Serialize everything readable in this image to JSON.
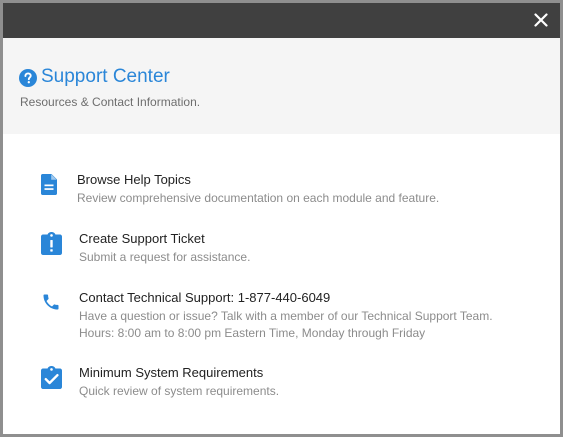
{
  "dialog": {
    "close_icon": "close-icon"
  },
  "header": {
    "icon": "help-circle-icon",
    "title": "Support Center",
    "subtitle": "Resources & Contact Information."
  },
  "colors": {
    "titlebar": "#404040",
    "header_bg": "#f5f5f5",
    "accent": "#2a86d8",
    "label": "#222222",
    "description": "#8c8c8c"
  },
  "items": [
    {
      "icon": "document-icon",
      "label": "Browse Help Topics",
      "description": "Review comprehensive documentation on each module and feature."
    },
    {
      "icon": "ticket-alert-icon",
      "label": "Create Support Ticket",
      "description": "Submit a request for assistance."
    },
    {
      "icon": "phone-icon",
      "label": "Contact Technical Support: 1-877-440-6049",
      "description": "Have a question or issue? Talk with a member of our Technical Support Team.",
      "description_line2": "Hours: 8:00 am to 8:00 pm Eastern Time, Monday through Friday"
    },
    {
      "icon": "clipboard-check-icon",
      "label": "Minimum System Requirements",
      "description": "Quick review of system requirements."
    }
  ]
}
